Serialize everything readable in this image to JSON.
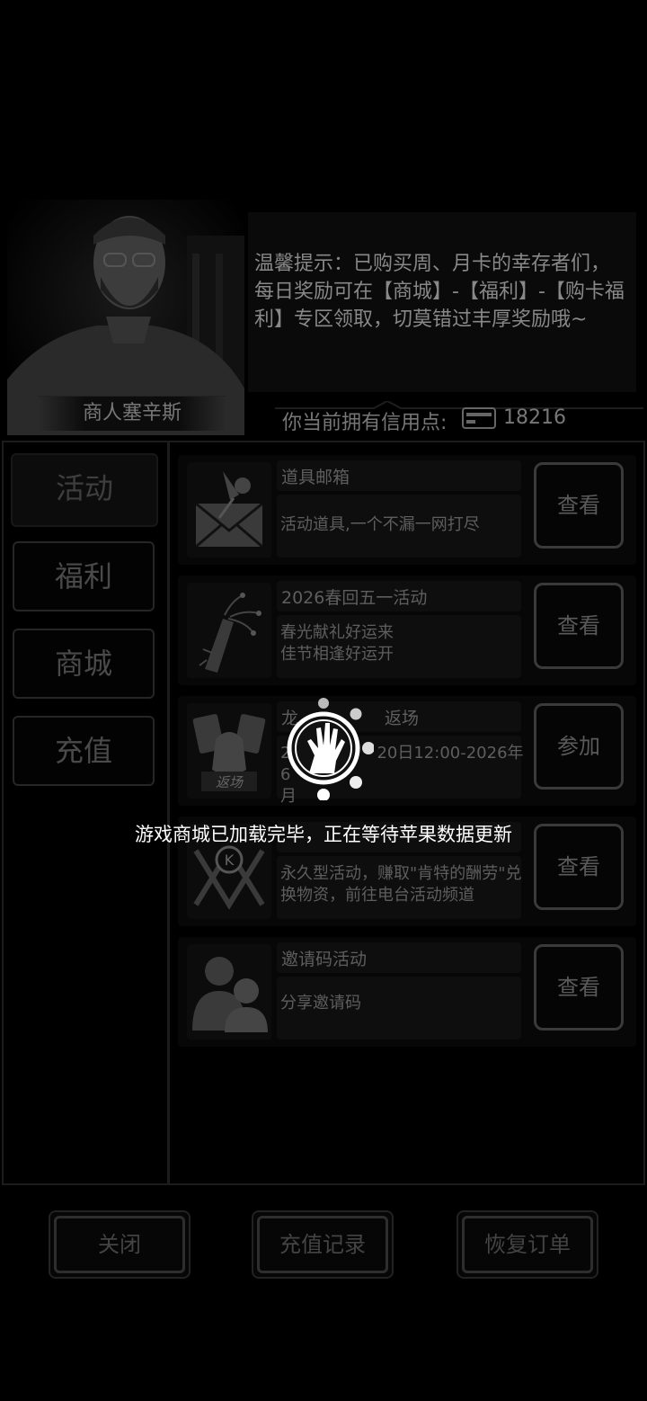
{
  "merchant": {
    "name": "商人塞辛斯"
  },
  "tip": {
    "text": "温馨提示：已购买周、月卡的幸存者们，每日奖励可在【商城】-【福利】-【购卡福利】专区领取，切莫错过丰厚奖励哦~"
  },
  "credits": {
    "label": "你当前拥有信用点:",
    "value": "18216"
  },
  "sidebar": {
    "items": [
      {
        "label": "活动"
      },
      {
        "label": "福利"
      },
      {
        "label": "商城"
      },
      {
        "label": "充值"
      }
    ]
  },
  "rows": [
    {
      "title": "道具邮箱",
      "desc": "活动道具,一个不漏一网打尽",
      "button": "查看",
      "icon": "mail-pin-icon"
    },
    {
      "title": "2026春回五一活动",
      "desc": "春光献礼好运来\n佳节相逢好运开",
      "button": "查看",
      "icon": "firecracker-icon"
    },
    {
      "title": "龙",
      "title_tail": "返场",
      "desc_head": "2",
      "desc_tail": "20日12:00-2026年6",
      "desc_line2": "月",
      "button": "参加",
      "icon": "return-bag-icon",
      "icon_label": "返场"
    },
    {
      "title": "",
      "desc": "永久型活动，赚取\"肯特的酬劳\"兑换物资，前往电台活动频道",
      "button": "查看",
      "icon": "k-emblem-icon",
      "icon_letter": "K"
    },
    {
      "title": "邀请码活动",
      "desc": "分享邀请码",
      "button": "查看",
      "icon": "users-icon"
    }
  ],
  "bottom": {
    "close": "关闭",
    "recharge_history": "充值记录",
    "restore_order": "恢复订单"
  },
  "loading": {
    "text": "游戏商城已加载完毕，正在等待苹果数据更新"
  }
}
